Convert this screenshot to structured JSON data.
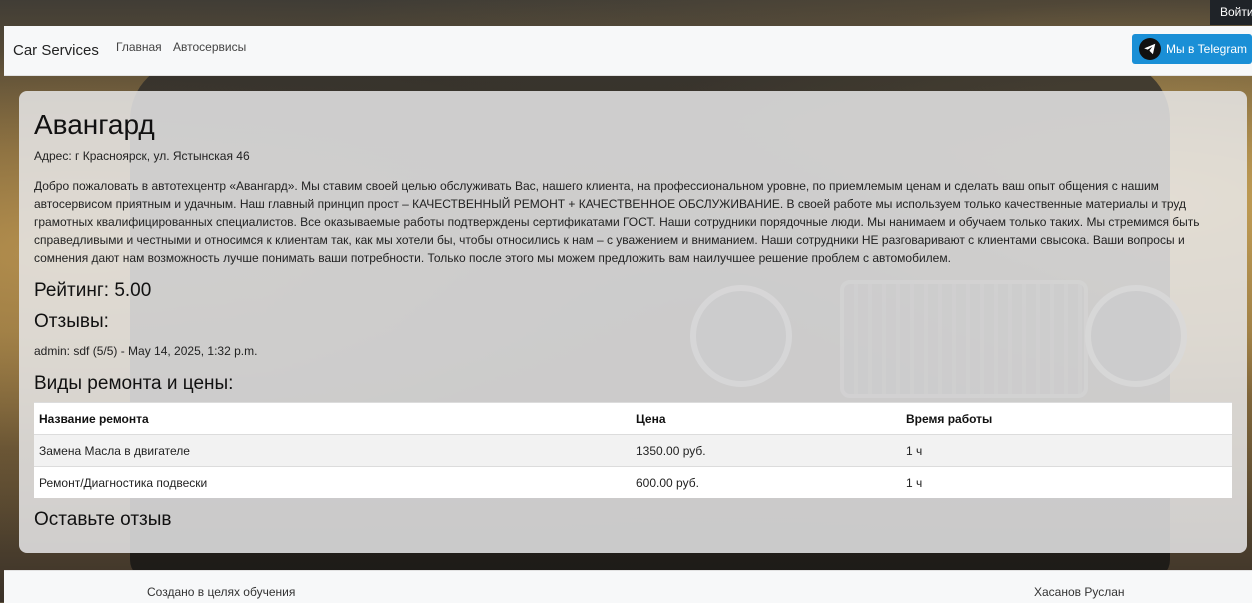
{
  "topbar": {
    "login_label": "Войти"
  },
  "navbar": {
    "brand": "Car Services",
    "links": [
      "Главная",
      "Автосервисы"
    ],
    "telegram_label": "Мы в Telegram",
    "telegram_icon": "telegram-icon",
    "telegram_color": "#1a8fd6"
  },
  "service": {
    "name": "Авангард",
    "address": "Адрес: г Красноярск, ул. Ястынская 46",
    "description": "Добро пожаловать в автотехцентр «Авангард». Мы ставим своей целью обслуживать Вас, нашего клиента, на профессиональном уровне, по приемлемым ценам и сделать ваш опыт общения с нашим автосервисом приятным и удачным. Наш главный принцип прост – КАЧЕСТВЕННЫЙ РЕМОНТ + КАЧЕСТВЕННОЕ ОБСЛУЖИВАНИЕ. В своей работе мы используем только качественные материалы и труд грамотных квалифицированных специалистов. Все оказываемые работы подтверждены сертификатами ГОСТ. Наши сотрудники порядочные люди. Мы нанимаем и обучаем только таких. Мы стремимся быть справедливыми и честными и относимся к клиентам так, как мы хотели бы, чтобы относились к нам – с уважением и вниманием. Наши сотрудники НЕ разговаривают с клиентами свысока. Ваши вопросы и сомнения дают нам возможность лучше понимать ваши потребности. Только после этого мы можем предложить вам наилучшее решение проблем с автомобилем.",
    "rating": "Рейтинг: 5.00",
    "reviews_heading": "Отзывы:",
    "reviews": [
      "admin: sdf (5/5) - May 14, 2025, 1:32 p.m."
    ],
    "repairs_heading": "Виды ремонта и цены:",
    "table": {
      "headers": [
        "Название ремонта",
        "Цена",
        "Время работы"
      ],
      "rows": [
        [
          "Замена Масла в двигателе",
          "1350.00 руб.",
          "1 ч"
        ],
        [
          "Ремонт/Диагностика подвески",
          "600.00 руб.",
          "1 ч"
        ]
      ]
    },
    "leave_review_heading": "Оставьте отзыв"
  },
  "footer": {
    "left": "Создано в целях обучения",
    "right": "Хасанов Руслан"
  }
}
